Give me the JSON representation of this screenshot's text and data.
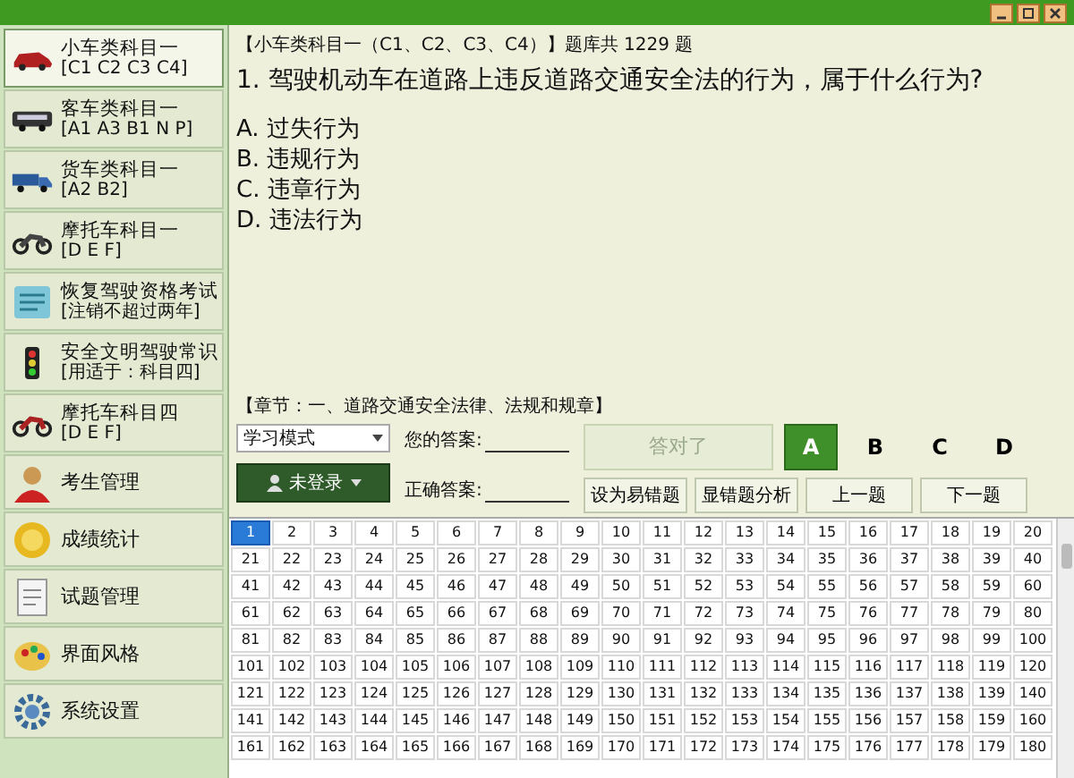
{
  "sidebar": {
    "items": [
      {
        "title": "小车类科目一",
        "subtitle": "[C1 C2 C3 C4]",
        "selected": true
      },
      {
        "title": "客车类科目一",
        "subtitle": "[A1 A3 B1 N P]",
        "selected": false
      },
      {
        "title": "货车类科目一",
        "subtitle": "[A2  B2]",
        "selected": false
      },
      {
        "title": "摩托车科目一",
        "subtitle": "[D  E  F]",
        "selected": false
      },
      {
        "title": "恢复驾驶资格考试",
        "subtitle": "[注销不超过两年]",
        "selected": false
      },
      {
        "title": "安全文明驾驶常识",
        "subtitle": "[用适于：科目四]",
        "selected": false
      },
      {
        "title": "摩托车科目四",
        "subtitle": "[D  E  F]",
        "selected": false
      },
      {
        "title": "考生管理",
        "selected": false
      },
      {
        "title": "成绩统计",
        "selected": false
      },
      {
        "title": "试题管理",
        "selected": false
      },
      {
        "title": "界面风格",
        "selected": false
      },
      {
        "title": "系统设置",
        "selected": false
      }
    ]
  },
  "quiz": {
    "header": "【小车类科目一（C1、C2、C3、C4）】题库共 1229 题",
    "question": "1. 驾驶机动车在道路上违反道路交通安全法的行为，属于什么行为?",
    "options": [
      "A. 过失行为",
      "B. 违规行为",
      "C. 违章行为",
      "D. 违法行为"
    ],
    "chapter": "【章节：一、道路交通安全法律、法规和规章】",
    "mode": "学习模式",
    "login_button": "未登录",
    "your_answer_label": "您的答案:",
    "correct_answer_label": "正确答案:",
    "result_button": {
      "label": "答对了",
      "disabled": true
    },
    "answer_buttons": [
      {
        "label": "A",
        "selected": true
      },
      {
        "label": "B",
        "selected": false
      },
      {
        "label": "C",
        "selected": false
      },
      {
        "label": "D",
        "selected": false
      }
    ],
    "actions": [
      "设为易错题",
      "显错题分析",
      "上一题",
      "下一题"
    ]
  },
  "grid": {
    "cells": [
      {
        "label": "1",
        "selected": true
      },
      {
        "label": "2",
        "selected": false
      },
      {
        "label": "3",
        "selected": false
      },
      {
        "label": "4",
        "selected": false
      },
      {
        "label": "5",
        "selected": false
      },
      {
        "label": "6",
        "selected": false
      },
      {
        "label": "7",
        "selected": false
      },
      {
        "label": "8",
        "selected": false
      },
      {
        "label": "9",
        "selected": false
      },
      {
        "label": "10",
        "selected": false
      },
      {
        "label": "11",
        "selected": false
      },
      {
        "label": "12",
        "selected": false
      },
      {
        "label": "13",
        "selected": false
      },
      {
        "label": "14",
        "selected": false
      },
      {
        "label": "15",
        "selected": false
      },
      {
        "label": "16",
        "selected": false
      },
      {
        "label": "17",
        "selected": false
      },
      {
        "label": "18",
        "selected": false
      },
      {
        "label": "19",
        "selected": false
      },
      {
        "label": "20",
        "selected": false
      },
      {
        "label": "21",
        "selected": false
      },
      {
        "label": "22",
        "selected": false
      },
      {
        "label": "23",
        "selected": false
      },
      {
        "label": "24",
        "selected": false
      },
      {
        "label": "25",
        "selected": false
      },
      {
        "label": "26",
        "selected": false
      },
      {
        "label": "27",
        "selected": false
      },
      {
        "label": "28",
        "selected": false
      },
      {
        "label": "29",
        "selected": false
      },
      {
        "label": "30",
        "selected": false
      },
      {
        "label": "31",
        "selected": false
      },
      {
        "label": "32",
        "selected": false
      },
      {
        "label": "33",
        "selected": false
      },
      {
        "label": "34",
        "selected": false
      },
      {
        "label": "35",
        "selected": false
      },
      {
        "label": "36",
        "selected": false
      },
      {
        "label": "37",
        "selected": false
      },
      {
        "label": "38",
        "selected": false
      },
      {
        "label": "39",
        "selected": false
      },
      {
        "label": "40",
        "selected": false
      },
      {
        "label": "41",
        "selected": false
      },
      {
        "label": "42",
        "selected": false
      },
      {
        "label": "43",
        "selected": false
      },
      {
        "label": "44",
        "selected": false
      },
      {
        "label": "45",
        "selected": false
      },
      {
        "label": "46",
        "selected": false
      },
      {
        "label": "47",
        "selected": false
      },
      {
        "label": "48",
        "selected": false
      },
      {
        "label": "49",
        "selected": false
      },
      {
        "label": "50",
        "selected": false
      },
      {
        "label": "51",
        "selected": false
      },
      {
        "label": "52",
        "selected": false
      },
      {
        "label": "53",
        "selected": false
      },
      {
        "label": "54",
        "selected": false
      },
      {
        "label": "55",
        "selected": false
      },
      {
        "label": "56",
        "selected": false
      },
      {
        "label": "57",
        "selected": false
      },
      {
        "label": "58",
        "selected": false
      },
      {
        "label": "59",
        "selected": false
      },
      {
        "label": "60",
        "selected": false
      },
      {
        "label": "61",
        "selected": false
      },
      {
        "label": "62",
        "selected": false
      },
      {
        "label": "63",
        "selected": false
      },
      {
        "label": "64",
        "selected": false
      },
      {
        "label": "65",
        "selected": false
      },
      {
        "label": "66",
        "selected": false
      },
      {
        "label": "67",
        "selected": false
      },
      {
        "label": "68",
        "selected": false
      },
      {
        "label": "69",
        "selected": false
      },
      {
        "label": "70",
        "selected": false
      },
      {
        "label": "71",
        "selected": false
      },
      {
        "label": "72",
        "selected": false
      },
      {
        "label": "73",
        "selected": false
      },
      {
        "label": "74",
        "selected": false
      },
      {
        "label": "75",
        "selected": false
      },
      {
        "label": "76",
        "selected": false
      },
      {
        "label": "77",
        "selected": false
      },
      {
        "label": "78",
        "selected": false
      },
      {
        "label": "79",
        "selected": false
      },
      {
        "label": "80",
        "selected": false
      },
      {
        "label": "81",
        "selected": false
      },
      {
        "label": "82",
        "selected": false
      },
      {
        "label": "83",
        "selected": false
      },
      {
        "label": "84",
        "selected": false
      },
      {
        "label": "85",
        "selected": false
      },
      {
        "label": "86",
        "selected": false
      },
      {
        "label": "87",
        "selected": false
      },
      {
        "label": "88",
        "selected": false
      },
      {
        "label": "89",
        "selected": false
      },
      {
        "label": "90",
        "selected": false
      },
      {
        "label": "91",
        "selected": false
      },
      {
        "label": "92",
        "selected": false
      },
      {
        "label": "93",
        "selected": false
      },
      {
        "label": "94",
        "selected": false
      },
      {
        "label": "95",
        "selected": false
      },
      {
        "label": "96",
        "selected": false
      },
      {
        "label": "97",
        "selected": false
      },
      {
        "label": "98",
        "selected": false
      },
      {
        "label": "99",
        "selected": false
      },
      {
        "label": "100",
        "selected": false
      },
      {
        "label": "101",
        "selected": false
      },
      {
        "label": "102",
        "selected": false
      },
      {
        "label": "103",
        "selected": false
      },
      {
        "label": "104",
        "selected": false
      },
      {
        "label": "105",
        "selected": false
      },
      {
        "label": "106",
        "selected": false
      },
      {
        "label": "107",
        "selected": false
      },
      {
        "label": "108",
        "selected": false
      },
      {
        "label": "109",
        "selected": false
      },
      {
        "label": "110",
        "selected": false
      },
      {
        "label": "111",
        "selected": false
      },
      {
        "label": "112",
        "selected": false
      },
      {
        "label": "113",
        "selected": false
      },
      {
        "label": "114",
        "selected": false
      },
      {
        "label": "115",
        "selected": false
      },
      {
        "label": "116",
        "selected": false
      },
      {
        "label": "117",
        "selected": false
      },
      {
        "label": "118",
        "selected": false
      },
      {
        "label": "119",
        "selected": false
      },
      {
        "label": "120",
        "selected": false
      },
      {
        "label": "121",
        "selected": false
      },
      {
        "label": "122",
        "selected": false
      },
      {
        "label": "123",
        "selected": false
      },
      {
        "label": "124",
        "selected": false
      },
      {
        "label": "125",
        "selected": false
      },
      {
        "label": "126",
        "selected": false
      },
      {
        "label": "127",
        "selected": false
      },
      {
        "label": "128",
        "selected": false
      },
      {
        "label": "129",
        "selected": false
      },
      {
        "label": "130",
        "selected": false
      },
      {
        "label": "131",
        "selected": false
      },
      {
        "label": "132",
        "selected": false
      },
      {
        "label": "133",
        "selected": false
      },
      {
        "label": "134",
        "selected": false
      },
      {
        "label": "135",
        "selected": false
      },
      {
        "label": "136",
        "selected": false
      },
      {
        "label": "137",
        "selected": false
      },
      {
        "label": "138",
        "selected": false
      },
      {
        "label": "139",
        "selected": false
      },
      {
        "label": "140",
        "selected": false
      },
      {
        "label": "141",
        "selected": false
      },
      {
        "label": "142",
        "selected": false
      },
      {
        "label": "143",
        "selected": false
      },
      {
        "label": "144",
        "selected": false
      },
      {
        "label": "145",
        "selected": false
      },
      {
        "label": "146",
        "selected": false
      },
      {
        "label": "147",
        "selected": false
      },
      {
        "label": "148",
        "selected": false
      },
      {
        "label": "149",
        "selected": false
      },
      {
        "label": "150",
        "selected": false
      },
      {
        "label": "151",
        "selected": false
      },
      {
        "label": "152",
        "selected": false
      },
      {
        "label": "153",
        "selected": false
      },
      {
        "label": "154",
        "selected": false
      },
      {
        "label": "155",
        "selected": false
      },
      {
        "label": "156",
        "selected": false
      },
      {
        "label": "157",
        "selected": false
      },
      {
        "label": "158",
        "selected": false
      },
      {
        "label": "159",
        "selected": false
      },
      {
        "label": "160",
        "selected": false
      },
      {
        "label": "161",
        "selected": false
      },
      {
        "label": "162",
        "selected": false
      },
      {
        "label": "163",
        "selected": false
      },
      {
        "label": "164",
        "selected": false
      },
      {
        "label": "165",
        "selected": false
      },
      {
        "label": "166",
        "selected": false
      },
      {
        "label": "167",
        "selected": false
      },
      {
        "label": "168",
        "selected": false
      },
      {
        "label": "169",
        "selected": false
      },
      {
        "label": "170",
        "selected": false
      },
      {
        "label": "171",
        "selected": false
      },
      {
        "label": "172",
        "selected": false
      },
      {
        "label": "173",
        "selected": false
      },
      {
        "label": "174",
        "selected": false
      },
      {
        "label": "175",
        "selected": false
      },
      {
        "label": "176",
        "selected": false
      },
      {
        "label": "177",
        "selected": false
      },
      {
        "label": "178",
        "selected": false
      },
      {
        "label": "179",
        "selected": false
      },
      {
        "label": "180",
        "selected": false
      }
    ]
  }
}
